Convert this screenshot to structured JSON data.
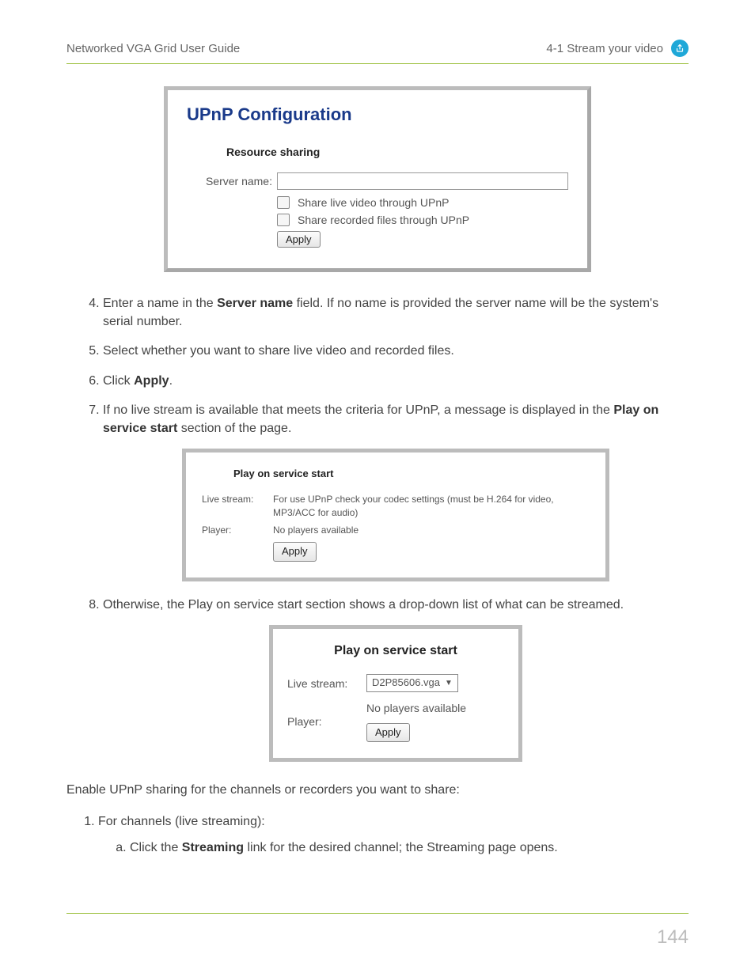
{
  "header": {
    "left": "Networked VGA Grid User Guide",
    "right": "4-1 Stream your video"
  },
  "panel1": {
    "title": "UPnP Configuration",
    "subtitle": "Resource sharing",
    "server_name_label": "Server name:",
    "opt_live": "Share live video through UPnP",
    "opt_rec": "Share recorded files through UPnP",
    "apply": "Apply"
  },
  "steps": {
    "s4a": "Enter a name in the ",
    "s4b": "Server name",
    "s4c": " field. If no name is provided the server name will be the system's serial number.",
    "s5": "Select whether you want to share live video and recorded files.",
    "s6a": "Click ",
    "s6b": "Apply",
    "s6c": ".",
    "s7a": "If no live stream is available that meets the criteria for UPnP, a message is displayed in the ",
    "s7b": "Play on service start",
    "s7c": " section of the page.",
    "s8": "Otherwise, the Play on service start section shows a drop-down list of what can be streamed."
  },
  "panel2": {
    "title": "Play on service start",
    "k1": "Live stream:",
    "v1": "For use UPnP check your codec settings (must be H.264 for video, MP3/ACC for audio)",
    "k2": "Player:",
    "v2": "No players available",
    "apply": "Apply"
  },
  "panel3": {
    "title": "Play on service start",
    "k1": "Live stream:",
    "sel": "D2P85606.vga",
    "k2": "Player:",
    "v2": "No players available",
    "apply": "Apply"
  },
  "tail": {
    "intro": "Enable UPnP sharing for the channels or recorders you want to share:",
    "li1": "For channels (live streaming):",
    "a1a": "Click the ",
    "a1b": "Streaming",
    "a1c": " link for the desired channel; the Streaming page opens."
  },
  "page_number": "144"
}
